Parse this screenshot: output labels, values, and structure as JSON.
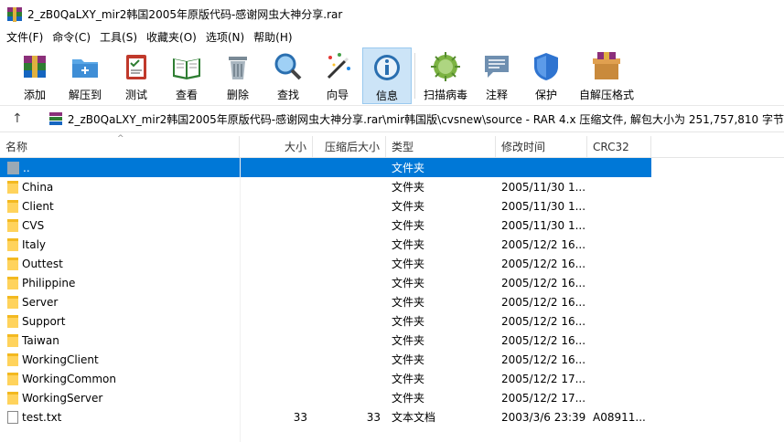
{
  "window": {
    "title": "2_zB0QaLXY_mir2韩国2005年原版代码-感谢网虫大神分享.rar",
    "colors": {
      "selection": "#0078d7",
      "folder": "#ffd35c"
    }
  },
  "menu": {
    "items": [
      {
        "label": "文件(F)"
      },
      {
        "label": "命令(C)"
      },
      {
        "label": "工具(S)"
      },
      {
        "label": "收藏夹(O)"
      },
      {
        "label": "选项(N)"
      },
      {
        "label": "帮助(H)"
      }
    ]
  },
  "toolbar": {
    "buttons": [
      {
        "label": "添加",
        "icon": "add-books-icon"
      },
      {
        "label": "解压到",
        "icon": "extract-folder-icon"
      },
      {
        "label": "测试",
        "icon": "test-clipboard-icon"
      },
      {
        "label": "查看",
        "icon": "view-book-icon"
      },
      {
        "label": "删除",
        "icon": "trash-icon"
      },
      {
        "label": "查找",
        "icon": "magnifier-icon"
      },
      {
        "label": "向导",
        "icon": "wizard-wand-icon"
      },
      {
        "label": "信息",
        "icon": "info-icon"
      },
      {
        "label": "扫描病毒",
        "icon": "virus-scan-icon"
      },
      {
        "label": "注释",
        "icon": "comment-icon"
      },
      {
        "label": "保护",
        "icon": "shield-icon"
      },
      {
        "label": "自解压格式",
        "icon": "sfx-box-icon"
      }
    ]
  },
  "address": {
    "path": "2_zB0QaLXY_mir2韩国2005年原版代码-感谢网虫大神分享.rar\\mir韩国版\\cvsnew\\source - RAR 4.x 压缩文件, 解包大小为 251,757,810 字节"
  },
  "columns": {
    "name": "名称",
    "size": "大小",
    "packed": "压缩后大小",
    "type": "类型",
    "modified": "修改时间",
    "crc": "CRC32"
  },
  "rows": [
    {
      "name": "..",
      "size": "",
      "packed": "",
      "type": "文件夹",
      "modified": "",
      "crc": "",
      "kind": "updir",
      "selected": true
    },
    {
      "name": "China",
      "size": "",
      "packed": "",
      "type": "文件夹",
      "modified": "2005/11/30 1...",
      "crc": "",
      "kind": "folder"
    },
    {
      "name": "Client",
      "size": "",
      "packed": "",
      "type": "文件夹",
      "modified": "2005/11/30 1...",
      "crc": "",
      "kind": "folder"
    },
    {
      "name": "CVS",
      "size": "",
      "packed": "",
      "type": "文件夹",
      "modified": "2005/11/30 1...",
      "crc": "",
      "kind": "folder"
    },
    {
      "name": "Italy",
      "size": "",
      "packed": "",
      "type": "文件夹",
      "modified": "2005/12/2 16...",
      "crc": "",
      "kind": "folder"
    },
    {
      "name": "Outtest",
      "size": "",
      "packed": "",
      "type": "文件夹",
      "modified": "2005/12/2 16...",
      "crc": "",
      "kind": "folder"
    },
    {
      "name": "Philippine",
      "size": "",
      "packed": "",
      "type": "文件夹",
      "modified": "2005/12/2 16...",
      "crc": "",
      "kind": "folder"
    },
    {
      "name": "Server",
      "size": "",
      "packed": "",
      "type": "文件夹",
      "modified": "2005/12/2 16...",
      "crc": "",
      "kind": "folder"
    },
    {
      "name": "Support",
      "size": "",
      "packed": "",
      "type": "文件夹",
      "modified": "2005/12/2 16...",
      "crc": "",
      "kind": "folder"
    },
    {
      "name": "Taiwan",
      "size": "",
      "packed": "",
      "type": "文件夹",
      "modified": "2005/12/2 16...",
      "crc": "",
      "kind": "folder"
    },
    {
      "name": "WorkingClient",
      "size": "",
      "packed": "",
      "type": "文件夹",
      "modified": "2005/12/2 16...",
      "crc": "",
      "kind": "folder"
    },
    {
      "name": "WorkingCommon",
      "size": "",
      "packed": "",
      "type": "文件夹",
      "modified": "2005/12/2 17...",
      "crc": "",
      "kind": "folder"
    },
    {
      "name": "WorkingServer",
      "size": "",
      "packed": "",
      "type": "文件夹",
      "modified": "2005/12/2 17...",
      "crc": "",
      "kind": "folder"
    },
    {
      "name": "test.txt",
      "size": "33",
      "packed": "33",
      "type": "文本文档",
      "modified": "2003/3/6 23:39",
      "crc": "A08911...",
      "kind": "file"
    }
  ]
}
